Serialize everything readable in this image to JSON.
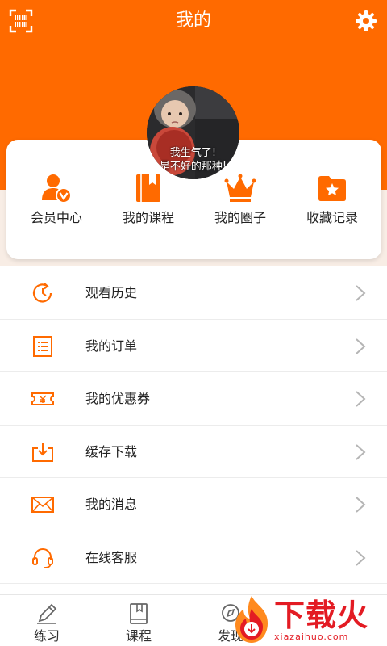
{
  "header": {
    "title": "我的"
  },
  "avatar": {
    "caption_line1": "我生气了!",
    "caption_line2": "是不好的那种!"
  },
  "quick_actions": [
    {
      "label": "会员中心",
      "icon": "member-icon"
    },
    {
      "label": "我的课程",
      "icon": "course-book-icon"
    },
    {
      "label": "我的圈子",
      "icon": "crown-icon"
    },
    {
      "label": "收藏记录",
      "icon": "star-folder-icon"
    }
  ],
  "menu": [
    {
      "label": "观看历史",
      "icon": "history-icon"
    },
    {
      "label": "我的订单",
      "icon": "order-list-icon"
    },
    {
      "label": "我的优惠券",
      "icon": "coupon-icon"
    },
    {
      "label": "缓存下载",
      "icon": "download-icon"
    },
    {
      "label": "我的消息",
      "icon": "mail-icon"
    },
    {
      "label": "在线客服",
      "icon": "headset-icon"
    }
  ],
  "tabbar": [
    {
      "label": "练习",
      "icon": "pencil-icon"
    },
    {
      "label": "课程",
      "icon": "book-icon"
    },
    {
      "label": "发现",
      "icon": "discover-icon"
    }
  ],
  "watermark": {
    "text": "下载火",
    "url": "xiazaihuo.com"
  },
  "colors": {
    "accent": "#ff6a00",
    "stage": "#f8ede5",
    "watermark": "#e31b23"
  }
}
